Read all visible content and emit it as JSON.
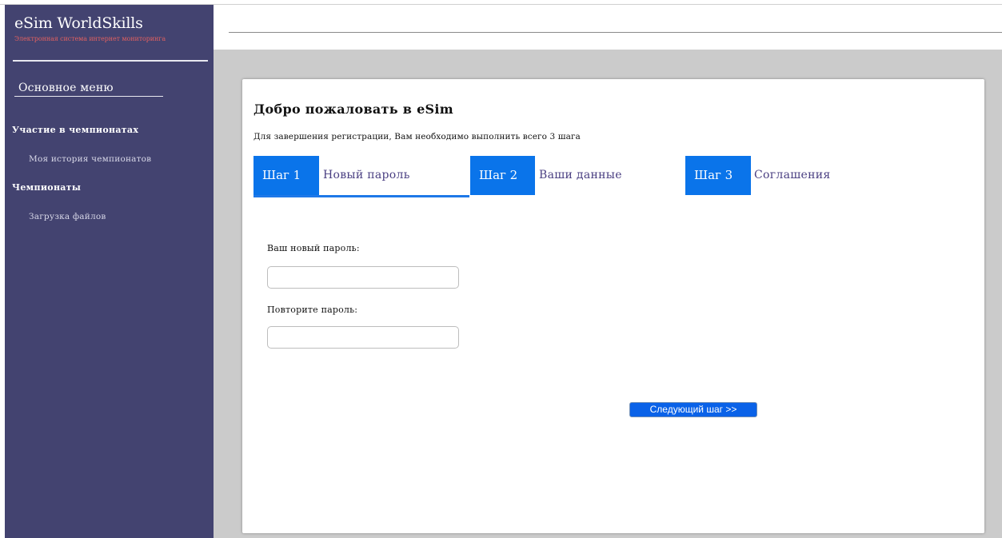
{
  "sidebar": {
    "brand_title": "eSim WorldSkills",
    "brand_subtitle": "Электронная система интернет мониторинга",
    "menu_heading": "Основное меню",
    "sections": [
      {
        "title": "Участие в чемпионатах",
        "links": [
          "Моя история чемпионатов"
        ]
      },
      {
        "title": "Чемпионаты",
        "links": [
          "Загрузка файлов"
        ]
      }
    ]
  },
  "card": {
    "title": "Добро пожаловать в eSim",
    "subtitle": "Для завершения регистрации, Вам необходимо выполнить всего 3 шага",
    "steps": [
      {
        "badge": "Шаг 1",
        "label": "Новый пароль",
        "active": true
      },
      {
        "badge": "Шаг 2",
        "label": "Ваши данные",
        "active": false
      },
      {
        "badge": "Шаг 3",
        "label": "Соглашения",
        "active": false
      }
    ],
    "form": {
      "new_password_label": "Ваш новый пароль:",
      "new_password_value": "",
      "repeat_password_label": "Повторите пароль:",
      "repeat_password_value": ""
    },
    "next_button_label": "Следующий шаг >>"
  },
  "colors": {
    "sidebar_bg": "#434370",
    "step_badge_bg": "#0a74ea",
    "step_label": "#4a3f82",
    "brand_subtitle": "#e06060",
    "next_button_bg": "#0a62e8"
  }
}
